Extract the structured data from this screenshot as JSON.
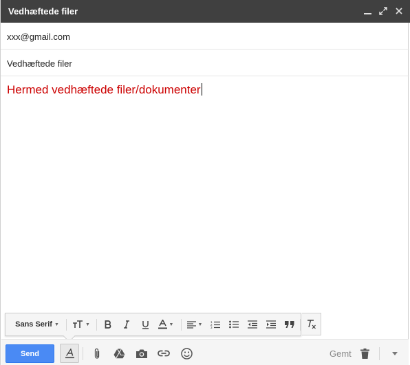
{
  "window": {
    "title": "Vedhæftede filer"
  },
  "titlebar_icons": [
    "minimize-icon",
    "expand-icon",
    "close-icon"
  ],
  "recipients": {
    "value": "xxx@gmail.com"
  },
  "subject": {
    "value": "Vedhæftede filer"
  },
  "body": {
    "text": "Hermed vedhæftede filer/dokumenter",
    "color": "#cc0000"
  },
  "format_toolbar": {
    "font": "Sans Serif",
    "icons": [
      "font-family-dropdown",
      "font-size-icon",
      "bold-icon",
      "italic-icon",
      "underline-icon",
      "text-color-icon",
      "align-icon",
      "numbered-list-icon",
      "bulleted-list-icon",
      "indent-less-icon",
      "indent-more-icon",
      "quote-icon",
      "remove-formatting-icon"
    ]
  },
  "bottom_toolbar": {
    "send_label": "Send",
    "saved_label": "Gemt",
    "send_color": "#4a8af4",
    "icons": [
      "formatting-options-icon",
      "attach-file-icon",
      "google-drive-icon",
      "insert-photo-icon",
      "insert-link-icon",
      "insert-emoji-icon",
      "discard-draft-icon",
      "more-options-icon"
    ]
  }
}
